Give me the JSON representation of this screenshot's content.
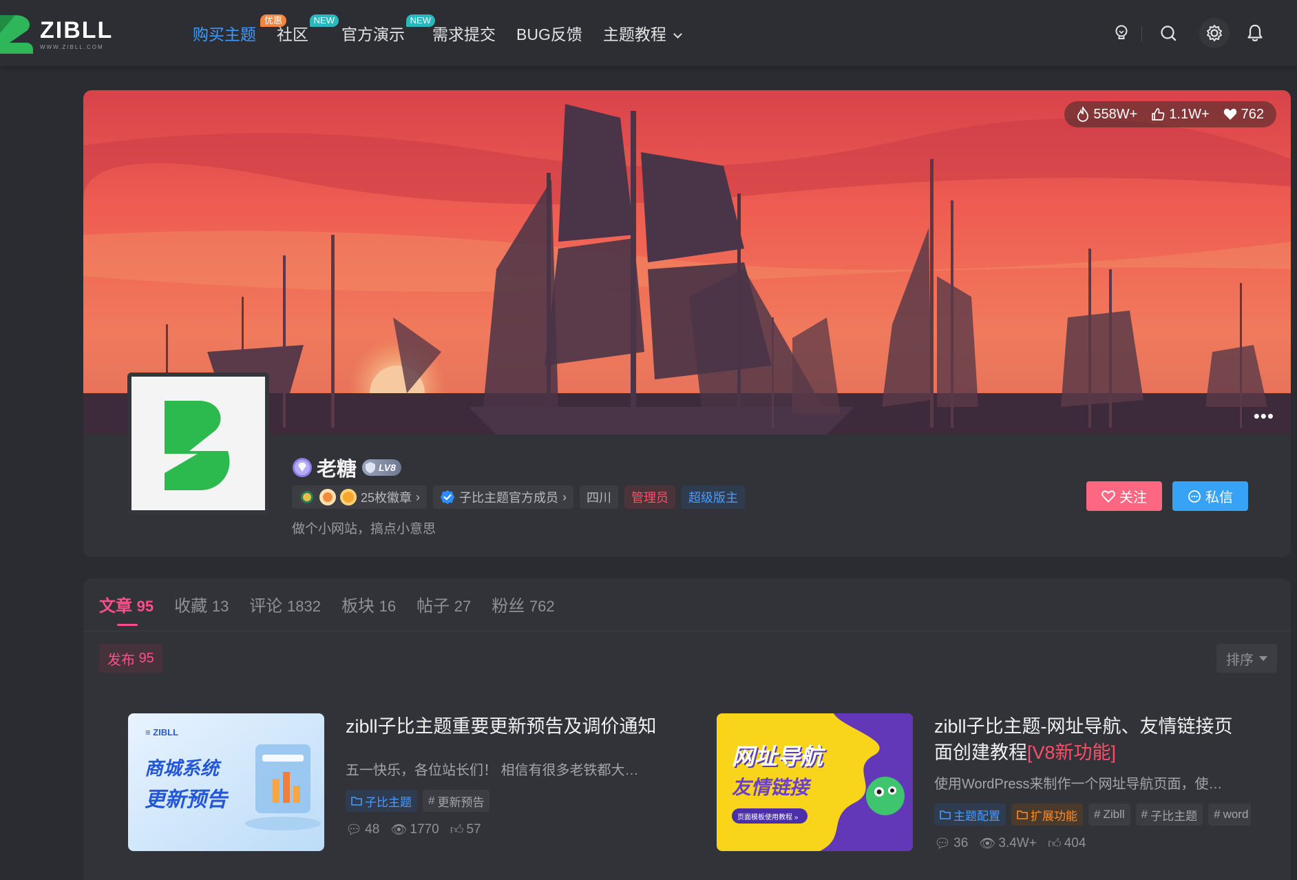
{
  "brand": {
    "name": "ZIBLL",
    "url_text": "WWW.ZIBLL.COM",
    "accent": "#2fb55a"
  },
  "nav": {
    "items": [
      {
        "label": "购买主题",
        "badge": "优惠",
        "badge_color": "#f9843b",
        "active": true
      },
      {
        "label": "社区",
        "badge": "NEW",
        "badge_color": "#2ab7bd"
      },
      {
        "label": "官方演示",
        "badge": "NEW",
        "badge_color": "#2ab7bd"
      },
      {
        "label": "需求提交"
      },
      {
        "label": "BUG反馈"
      },
      {
        "label": "主题教程",
        "has_dropdown": true
      }
    ],
    "right_icons": [
      "idea-icon",
      "search-icon",
      "gear-icon",
      "bell-icon"
    ]
  },
  "profile": {
    "stats": {
      "views": "558W+",
      "likes": "1.1W+",
      "favorites": "762"
    },
    "name": "老糖",
    "level": "LV8",
    "medals_label": "25枚徽章",
    "verified_label": "子比主题官方成员",
    "location": "四川",
    "role_admin": "管理员",
    "role_moderator": "超级版主",
    "bio": "做个小网站，搞点小意思",
    "follow_label": "关注",
    "message_label": "私信"
  },
  "tabs": [
    {
      "label": "文章",
      "count": "95",
      "active": true
    },
    {
      "label": "收藏",
      "count": "13"
    },
    {
      "label": "评论",
      "count": "1832"
    },
    {
      "label": "板块",
      "count": "16"
    },
    {
      "label": "帖子",
      "count": "27"
    },
    {
      "label": "粉丝",
      "count": "762"
    }
  ],
  "filter": {
    "publish_label": "发布",
    "publish_count": "95",
    "sort_label": "排序"
  },
  "posts": [
    {
      "title": "zibll子比主题重要更新预告及调价通知",
      "title_highlight": "",
      "excerpt": "五一快乐，各位站长们！ 相信有很多老铁都大…",
      "thumb_text_1": "商城系统",
      "thumb_text_2": "更新预告",
      "tags": [
        {
          "label": "子比主题",
          "type": "category"
        },
        {
          "label": "更新预告",
          "type": "hashtag"
        }
      ],
      "comments": "48",
      "views": "1770",
      "likes": "57"
    },
    {
      "title": "zibll子比主题-网址导航、友情链接页面创建教程",
      "title_highlight": "[V8新功能]",
      "excerpt": "使用WordPress来制作一个网址导航页面，使…",
      "thumb_text_1": "网址导航",
      "thumb_text_2": "友情链接",
      "thumb_button": "页面模板使用教程 »",
      "tags": [
        {
          "label": "主题配置",
          "type": "category"
        },
        {
          "label": "扩展功能",
          "type": "category-orange"
        },
        {
          "label": "Zibll",
          "type": "hashtag"
        },
        {
          "label": "子比主题",
          "type": "hashtag"
        },
        {
          "label": "word",
          "type": "hashtag"
        }
      ],
      "comments": "36",
      "views": "3.4W+",
      "likes": "404"
    }
  ]
}
